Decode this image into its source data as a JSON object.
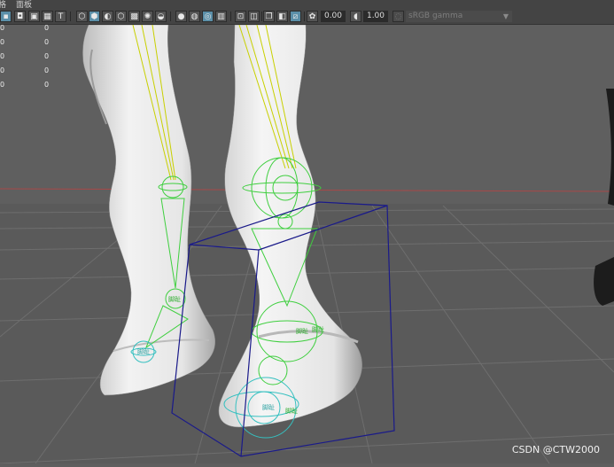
{
  "menu": {
    "items": [
      "格",
      "面板"
    ]
  },
  "toolbar": {
    "exposure_value": "0.00",
    "gamma_value": "1.00",
    "color_space": "sRGB gamma"
  },
  "hud": {
    "rows": [
      {
        "a": "0",
        "b": "0"
      },
      {
        "a": "0",
        "b": "0"
      },
      {
        "a": "0",
        "b": "0"
      },
      {
        "a": "0",
        "b": "0"
      },
      {
        "a": "0",
        "b": "0"
      }
    ]
  },
  "viewport": {
    "joint_labels": [
      "脚趾",
      "脚趾",
      "脚趾",
      "脚趾",
      "脚趾",
      "脚趾"
    ],
    "colors": {
      "skin": "#e8e8e8",
      "yellow_rig": "#c8d000",
      "green_rig": "#3fcf3f",
      "cyan_rig": "#35c0c0",
      "bbox": "#1a1a8a",
      "grid": "#777777",
      "horizon_axis": "#b24a4a"
    }
  },
  "watermark": "CSDN @CTW2000"
}
